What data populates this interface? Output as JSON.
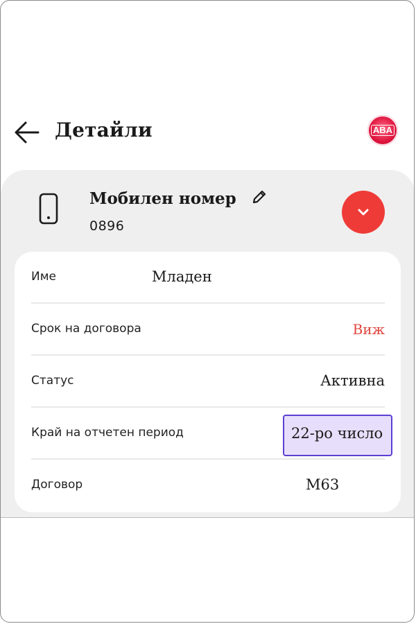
{
  "header": {
    "title": "Детайли",
    "avatar_text": "ABA"
  },
  "account": {
    "title": "Мобилен номер",
    "number": "0896"
  },
  "details": {
    "rows": [
      {
        "label": "Име",
        "value": "Младен"
      },
      {
        "label": "Срок на договора",
        "value": "Виж"
      },
      {
        "label": "Статус",
        "value": "Активна"
      },
      {
        "label": "Край на отчетен период",
        "value": "22-ро число"
      },
      {
        "label": "Договор",
        "value": "M63"
      }
    ]
  },
  "icons": {
    "back": "arrow-left-icon",
    "device": "smartphone-icon",
    "edit": "pencil-icon",
    "expand": "chevron-down-icon"
  },
  "colors": {
    "accent": "#ef3b37",
    "link": "#e0463f",
    "highlight_bg": "#e6defa",
    "highlight_border": "#5b3fd4",
    "panel_bg": "#efefef"
  }
}
